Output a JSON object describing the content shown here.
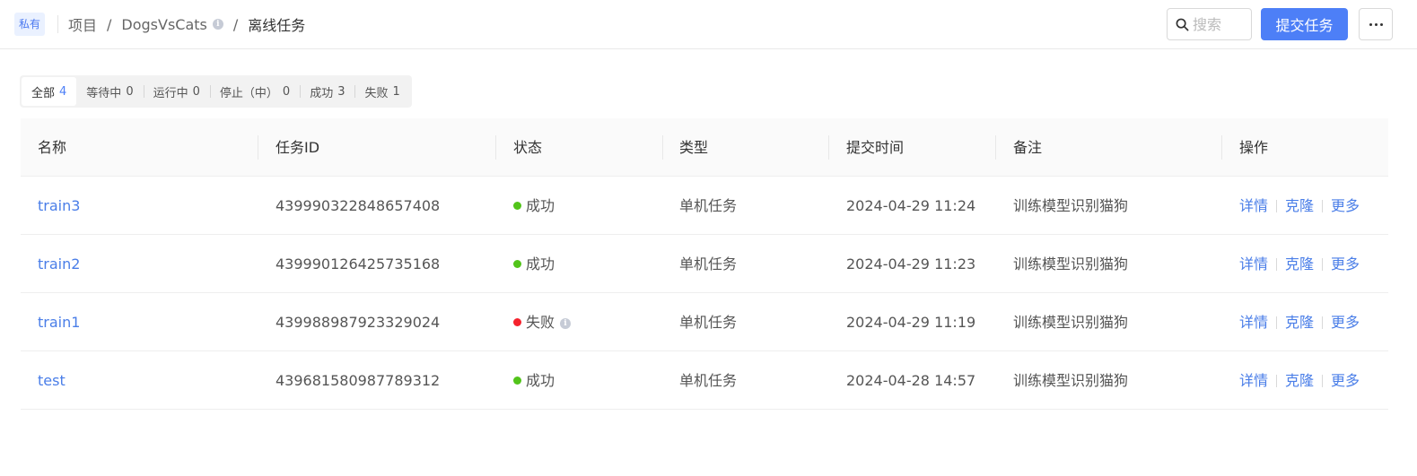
{
  "header": {
    "badge": "私有",
    "breadcrumb": [
      "项目",
      "DogsVsCats",
      "离线任务"
    ],
    "separator": "/",
    "search_placeholder": "搜索",
    "submit_label": "提交任务"
  },
  "filters": [
    {
      "label": "全部",
      "count": "4"
    },
    {
      "label": "等待中",
      "count": "0"
    },
    {
      "label": "运行中",
      "count": "0"
    },
    {
      "label": "停止（中）",
      "count": "0"
    },
    {
      "label": "成功",
      "count": "3"
    },
    {
      "label": "失败",
      "count": "1"
    }
  ],
  "table": {
    "columns": [
      "名称",
      "任务ID",
      "状态",
      "类型",
      "提交时间",
      "备注",
      "操作"
    ],
    "rows": [
      {
        "name": "train3",
        "id": "439990322848657408",
        "status": "成功",
        "status_color": "#52c41a",
        "type": "单机任务",
        "time": "2024-04-29 11:24",
        "note": "训练模型识别猫狗"
      },
      {
        "name": "train2",
        "id": "439990126425735168",
        "status": "成功",
        "status_color": "#52c41a",
        "type": "单机任务",
        "time": "2024-04-29 11:23",
        "note": "训练模型识别猫狗"
      },
      {
        "name": "train1",
        "id": "439988987923329024",
        "status": "失败",
        "status_color": "#f5222d",
        "type": "单机任务",
        "time": "2024-04-29 11:19",
        "note": "训练模型识别猫狗"
      },
      {
        "name": "test",
        "id": "439681580987789312",
        "status": "成功",
        "status_color": "#52c41a",
        "type": "单机任务",
        "time": "2024-04-28 14:57",
        "note": "训练模型识别猫狗"
      }
    ],
    "actions": [
      "详情",
      "克隆",
      "更多"
    ]
  },
  "colors": {
    "accent": "#4d7ff7",
    "success": "#52c41a",
    "failure": "#f5222d"
  }
}
